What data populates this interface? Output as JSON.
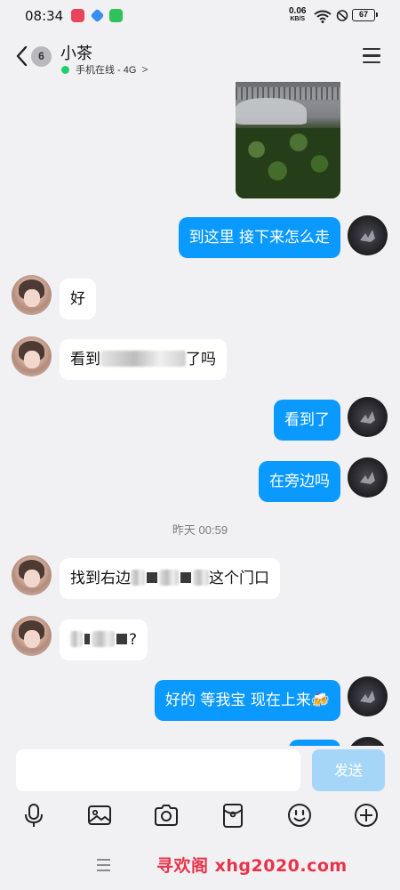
{
  "status_bar": {
    "time": "08:34",
    "net_speed": "0.06",
    "net_unit": "KB/S",
    "battery": "67"
  },
  "header": {
    "back_badge": "6",
    "contact_name": "小茶",
    "online_status": "手机在线 - 4G",
    "online_arrow": ">"
  },
  "messages": [
    {
      "side": "out",
      "type": "image"
    },
    {
      "side": "out",
      "text": "到这里 接下来怎么走"
    },
    {
      "side": "in",
      "text": "好"
    },
    {
      "side": "in",
      "prefix": "看到",
      "suffix": "了吗",
      "redacted": true
    },
    {
      "side": "out",
      "text": "看到了"
    },
    {
      "side": "out",
      "text": "在旁边吗"
    },
    {
      "side": "in",
      "prefix": "找到右边",
      "suffix": "这个门口",
      "redacted": true
    },
    {
      "side": "in",
      "suffix": "?",
      "redacted": true
    },
    {
      "side": "out",
      "text": "好的 等我宝 现在上来🍻"
    }
  ],
  "timestamp": "昨天 00:59",
  "input": {
    "value": "",
    "send_label": "发送"
  },
  "toolbar_icons": [
    "microphone-icon",
    "image-icon",
    "camera-icon",
    "red-packet-icon",
    "emoji-icon",
    "plus-icon"
  ],
  "watermark": "寻欢阁 xhg2020.com",
  "colors": {
    "accent": "#0a99ff",
    "send_disabled": "#a5d6f8",
    "online": "#1fcf6c",
    "background": "#f1f1f3"
  }
}
